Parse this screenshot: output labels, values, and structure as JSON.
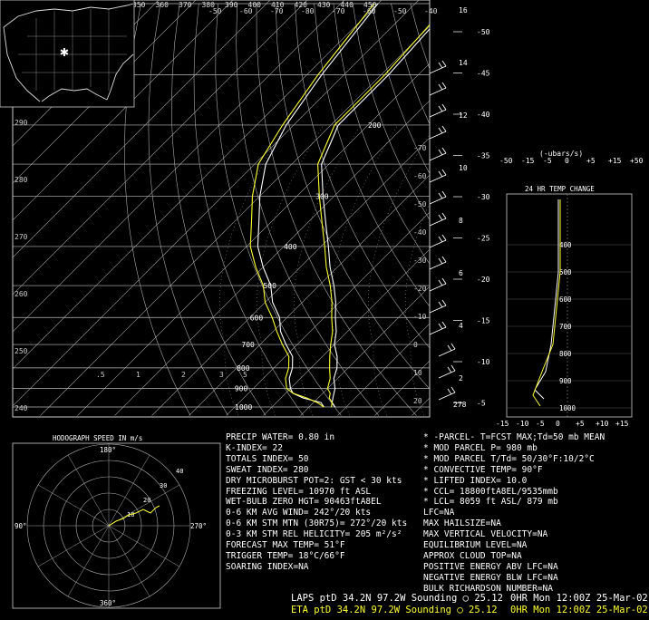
{
  "skewt": {
    "temp_labels_top": [
      "-50",
      "-60",
      "-70",
      "-80",
      "-70",
      "-60",
      "-50",
      "-40"
    ],
    "theta_labels_top": [
      "350",
      "360",
      "370",
      "380",
      "390",
      "400",
      "410",
      "420",
      "430",
      "440",
      "450"
    ],
    "mixing_ratio_labels": [
      ".5",
      "1",
      "2",
      "3",
      "5"
    ],
    "pressure_labels": [
      "200",
      "300",
      "400",
      "500",
      "600",
      "700",
      "800",
      "900",
      "1000"
    ],
    "theta_left_labels": [
      "290",
      "280",
      "270",
      "260",
      "250",
      "240"
    ],
    "temp_mid_labels": [
      "20",
      "10",
      "0",
      "-10",
      "-20",
      "-30",
      "-40",
      "-50",
      "-60",
      "-70"
    ],
    "height_ft_labels": [
      "50",
      "45",
      "40",
      "35",
      "30",
      "25",
      "20",
      "15",
      "10",
      "5"
    ],
    "height_km_labels": [
      "16",
      "14",
      "12",
      "10",
      "8",
      "6",
      "4",
      "2"
    ],
    "surface_height": "278"
  },
  "chart_data": {
    "type": "line",
    "title": "",
    "xlabel": "",
    "ylabel": "",
    "series": [
      {
        "name": "LAPS",
        "color": "#ffffff",
        "pressure": [
          1000,
          975,
          950,
          925,
          900,
          850,
          800,
          750,
          700,
          650,
          600,
          550,
          500,
          450,
          400,
          350,
          300,
          250,
          200,
          150,
          100
        ],
        "temp": [
          17,
          15,
          14,
          13,
          12,
          9,
          7,
          4,
          0,
          -3,
          -7,
          -11,
          -16,
          -22,
          -28,
          -35,
          -43,
          -52,
          -58,
          -58,
          -60
        ],
        "dewpoint": [
          14,
          12,
          6,
          2,
          0,
          -3,
          -5,
          -8,
          -13,
          -18,
          -22,
          -28,
          -33,
          -40,
          -47,
          -53,
          -60,
          -67,
          -72,
          -76,
          -80
        ]
      },
      {
        "name": "ETA",
        "color": "#ffff33",
        "pressure": [
          1000,
          975,
          950,
          925,
          900,
          850,
          800,
          750,
          700,
          650,
          600,
          550,
          500,
          450,
          400,
          350,
          300,
          250,
          200,
          150,
          100
        ],
        "temp": [
          16,
          15,
          13,
          12,
          10,
          8,
          5,
          2,
          -1,
          -4,
          -8,
          -12,
          -17,
          -23,
          -29,
          -36,
          -44,
          -53,
          -59,
          -59,
          -61
        ],
        "dewpoint": [
          14,
          11,
          7,
          2,
          -1,
          -4,
          -6,
          -9,
          -14,
          -19,
          -24,
          -30,
          -35,
          -42,
          -49,
          -55,
          -62,
          -69,
          -73,
          -77,
          -81
        ]
      }
    ]
  },
  "change_panel": {
    "units_label": "(-ubars/s)",
    "omega_axis": [
      "-50",
      "-15",
      "-5",
      "0",
      "+5",
      "+15",
      "+50"
    ],
    "title": "24 HR TEMP CHANGE",
    "temp_axis": [
      "-15",
      "-10",
      "-5",
      "0",
      "+5",
      "+10",
      "+15"
    ],
    "pressure_labels": [
      "400",
      "500",
      "600",
      "700",
      "800",
      "900",
      "1000"
    ]
  },
  "hodograph": {
    "title": "HODOGRAPH SPEED IN m/s",
    "dir_labels": {
      "n": "180°",
      "e": "270°",
      "s": "360°",
      "w": "90°"
    },
    "ring_labels": [
      "10",
      "20",
      "30",
      "40"
    ]
  },
  "stats_left": [
    "PRECIP WATER= 0.80 in",
    "K-INDEX= 22",
    "TOTALS INDEX= 50",
    "SWEAT INDEX= 280",
    "DRY MICROBURST POT=2: GST < 30 kts",
    "FREEZING LEVEL= 10970 ft ASL",
    "WET-BULB ZERO HGT= 90463ftA8EL",
    "0-6 KM AVG WIND= 242°/20 kts",
    "0-6 KM STM MTN (30R75)= 272°/20 kts",
    "0-3 KM STM REL HELICITY= 205 m²/s²",
    "FORECAST MAX TEMP= 51°F",
    "TRIGGER TEMP= 18°C/66°F",
    "SOARING INDEX=NA"
  ],
  "stats_right": [
    "* -PARCEL- T=FCST MAX;Td=50 mb MEAN",
    "* MOD PARCEL P= 980 mb",
    "* MOD PARCEL T/Td= 50/30°F:10/2°C",
    "* CONVECTIVE TEMP= 90°F",
    "* LIFTED INDEX= 10.0",
    "* CCL= 18800ftA8EL/9535mmb",
    "* LCL= 8059 ft ASL/ 879 mb",
    "LFC=NA",
    "MAX HAILSIZE=NA",
    "MAX VERTICAL VELOCITY=NA",
    "EQUILIBRIUM LEVEL=NA",
    "APPROX CLOUD TOP=NA",
    "POSITIVE ENERGY ABV LFC=NA",
    "NEGATIVE ENERGY BLW LFC=NA",
    "BULK RICHARDSON NUMBER=NA"
  ],
  "footer": {
    "line1_left": "LAPS ptD 34.2N 97.2W Sounding",
    "line1_val": "25.12",
    "line1_right": "0HR Mon 12:00Z 25-Mar-02",
    "line2_left": "ETA ptD 34.2N 97.2W Sounding",
    "line2_val": "25.12",
    "line2_right": "0HR Mon 12:00Z 25-Mar-02"
  },
  "colors": {
    "laps": "#ffffff",
    "eta": "#ffff33",
    "grid": "#d8d8d8",
    "hodo": "#ffff33"
  }
}
